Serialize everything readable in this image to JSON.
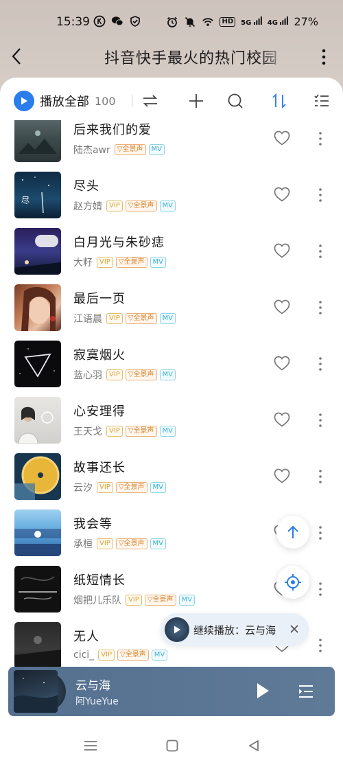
{
  "status_bar": {
    "time": "15:39",
    "battery": "27%",
    "network_badge": "HD",
    "signal_1": "5G",
    "signal_2": "4G",
    "left_icons": [
      "k-circle-icon",
      "wechat-icon",
      "shield-check-icon"
    ],
    "right_icons": [
      "alarm-icon",
      "mute-icon",
      "wifi-icon"
    ]
  },
  "header": {
    "title": "抖音快手最火的热门校园",
    "back_icon": "chevron-left-icon",
    "more_icon": "vertical-dots-icon"
  },
  "toolbar": {
    "play_all_label": "播放全部",
    "count": "100",
    "icons": [
      "repeat-icon",
      "add-icon",
      "search-icon",
      "sort-icon",
      "multi-select-icon"
    ],
    "accent": "#2a7dea"
  },
  "songs": [
    {
      "title": "后来我们的爱",
      "artist": "陆杰awr",
      "vip": false,
      "sound": "全景声",
      "mv": "MV"
    },
    {
      "title": "尽头",
      "artist": "赵方婧",
      "vip": "VIP",
      "sound": "全景声",
      "mv": "MV"
    },
    {
      "title": "白月光与朱砂痣",
      "artist": "大籽",
      "vip": "VIP",
      "sound": "全景声",
      "mv": "MV"
    },
    {
      "title": "最后一页",
      "artist": "江语晨",
      "vip": "VIP",
      "sound": "全景声",
      "mv": "MV"
    },
    {
      "title": "寂寞烟火",
      "artist": "蓝心羽",
      "vip": "VIP",
      "sound": "全景声",
      "mv": "MV"
    },
    {
      "title": "心安理得",
      "artist": "王天戈",
      "vip": "VIP",
      "sound": "全景声",
      "mv": "MV"
    },
    {
      "title": "故事还长",
      "artist": "云汐",
      "vip": "VIP",
      "sound": "全景声",
      "mv": "MV"
    },
    {
      "title": "我会等",
      "artist": "承桓",
      "vip": "VIP",
      "sound": "全景声",
      "mv": "MV"
    },
    {
      "title": "纸短情长",
      "artist": "烟把儿乐队",
      "vip": "VIP",
      "sound": "全景声",
      "mv": "MV"
    },
    {
      "title": "无人",
      "artist": "cici_",
      "vip": "VIP",
      "sound": "全景声",
      "mv": "MV"
    }
  ],
  "floating": {
    "scroll_top_icon": "arrow-up-icon",
    "locate_icon": "locate-icon",
    "resume_label": "继续播放：云与海"
  },
  "mini_player": {
    "title": "云与海",
    "artist": "阿YueYue",
    "play_icon": "play-icon",
    "queue_icon": "queue-icon"
  },
  "nav": {
    "icons": [
      "menu-icon",
      "home-icon",
      "back-triangle-icon"
    ]
  }
}
